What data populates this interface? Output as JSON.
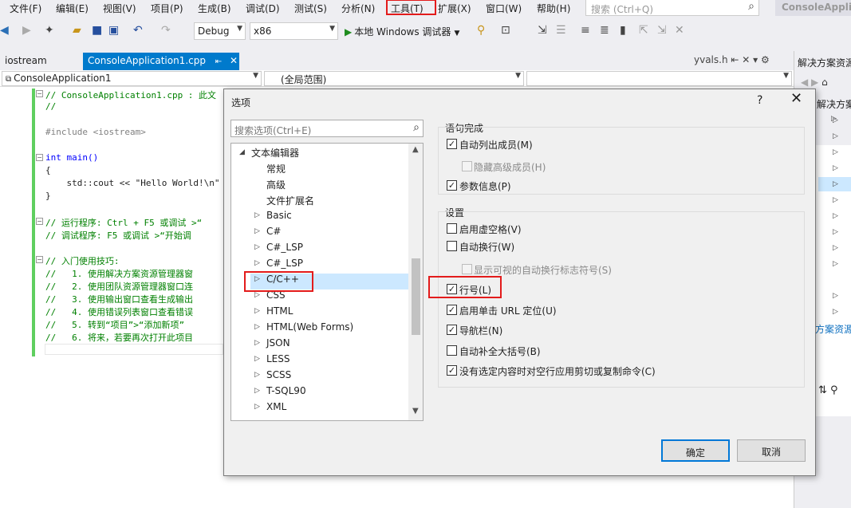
{
  "menubar": {
    "items": [
      "文件(F)",
      "编辑(E)",
      "视图(V)",
      "项目(P)",
      "生成(B)",
      "调试(D)",
      "测试(S)",
      "分析(N)",
      "工具(T)",
      "扩展(X)",
      "窗口(W)",
      "帮助(H)"
    ],
    "search_placeholder": "搜索 (Ctrl+Q)",
    "app_title": "ConsoleApplication"
  },
  "toolbar": {
    "config": "Debug",
    "platform": "x86",
    "run_label": "本地 Windows 调试器"
  },
  "tabs": {
    "inactive": "iostream",
    "active": "ConsoleApplication1.cpp",
    "pin": "⇤",
    "close": "✕",
    "right_file": "yvals.h"
  },
  "navbar": {
    "project": "ConsoleApplication1",
    "scope": "(全局范围)"
  },
  "editor": {
    "lines": [
      "// ConsoleApplication1.cpp : 此文",
      "//",
      "",
      "#include <iostream>",
      "",
      "int main()",
      "{",
      "    std::cout << \"Hello World!\\n\"",
      "}",
      "",
      "// 运行程序: Ctrl + F5 或调试 >“",
      "// 调试程序: F5 或调试 >“开始调",
      "",
      "// 入门使用技巧:",
      "//   1. 使用解决方案资源管理器窗",
      "//   2. 使用团队资源管理器窗口连",
      "//   3. 使用输出窗口查看生成输出",
      "//   4. 使用错误列表窗口查看错误",
      "//   5. 转到“项目”>“添加新项”",
      "//   6. 将来，若要再次打开此项目"
    ]
  },
  "solution": {
    "title": "解决方案资源",
    "tree_label": "解决方案",
    "footer_label": "方案资源"
  },
  "dialog": {
    "title": "选项",
    "help": "?",
    "close": "✕",
    "search_placeholder": "搜索选项(Ctrl+E)",
    "tree": {
      "root": "文本编辑器",
      "children": [
        "常规",
        "高级",
        "文件扩展名",
        "Basic",
        "C#",
        "C#_LSP",
        "C#_LSP",
        "C/C++",
        "CSS",
        "HTML",
        "HTML(Web Forms)",
        "JSON",
        "LESS",
        "SCSS",
        "T-SQL90",
        "XML"
      ]
    },
    "group1": {
      "label": "语句完成",
      "options": [
        {
          "label": "自动列出成员(M)",
          "checked": true,
          "disabled": false
        },
        {
          "label": "隐藏高级成员(H)",
          "checked": false,
          "disabled": true
        },
        {
          "label": "参数信息(P)",
          "checked": true,
          "disabled": false
        }
      ]
    },
    "group2": {
      "label": "设置",
      "options": [
        {
          "label": "启用虚空格(V)",
          "checked": false,
          "disabled": false
        },
        {
          "label": "自动换行(W)",
          "checked": false,
          "disabled": false
        },
        {
          "label": "显示可视的自动换行标志符号(S)",
          "checked": false,
          "disabled": true
        },
        {
          "label": "行号(L)",
          "checked": true,
          "disabled": false
        },
        {
          "label": "启用单击 URL 定位(U)",
          "checked": true,
          "disabled": false
        },
        {
          "label": "导航栏(N)",
          "checked": true,
          "disabled": false
        },
        {
          "label": "自动补全大括号(B)",
          "checked": false,
          "disabled": false
        },
        {
          "label": "没有选定内容时对空行应用剪切或复制命令(C)",
          "checked": true,
          "disabled": false
        }
      ]
    },
    "ok": "确定",
    "cancel": "取消"
  }
}
